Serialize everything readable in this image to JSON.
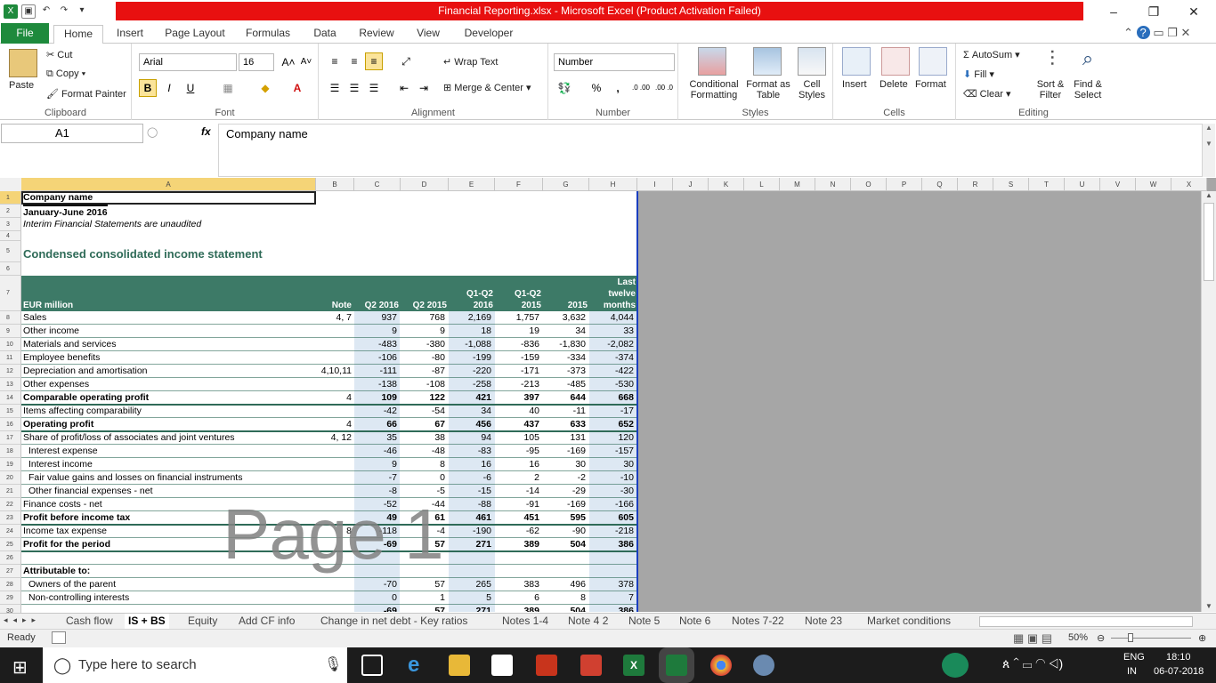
{
  "window": {
    "title": "Financial Reporting.xlsx  -  Microsoft Excel (Product Activation Failed)",
    "controls": {
      "minimize": "–",
      "restore": "❐",
      "close": "✕"
    }
  },
  "ribbon_tabs": [
    "File",
    "Home",
    "Insert",
    "Page Layout",
    "Formulas",
    "Data",
    "Review",
    "View",
    "Developer"
  ],
  "clipboard": {
    "paste": "Paste",
    "cut": "Cut",
    "copy": "Copy",
    "format_painter": "Format Painter",
    "label": "Clipboard"
  },
  "font": {
    "name": "Arial",
    "size": "16",
    "bold": "B",
    "italic": "I",
    "underline": "U",
    "label": "Font"
  },
  "alignment": {
    "wrap": "Wrap Text",
    "merge": "Merge & Center",
    "label": "Alignment"
  },
  "number": {
    "format": "Number",
    "percent": "%",
    "comma": ",",
    "inc": ".0 .00",
    "dec": ".00 .0",
    "label": "Number"
  },
  "styles": {
    "conditional": "Conditional Formatting",
    "format_table": "Format as Table",
    "cell_styles": "Cell Styles",
    "label": "Styles"
  },
  "cells": {
    "insert": "Insert",
    "delete": "Delete",
    "format": "Format",
    "label": "Cells"
  },
  "editing": {
    "autosum": "AutoSum",
    "fill": "Fill",
    "clear": "Clear",
    "sort": "Sort & Filter",
    "find": "Find & Select",
    "label": "Editing"
  },
  "formula_bar": {
    "name_box": "A1",
    "fx": "fx",
    "content": "Company name"
  },
  "columns": [
    "A",
    "B",
    "C",
    "D",
    "E",
    "F",
    "G",
    "H",
    "I",
    "J",
    "K",
    "L",
    "M",
    "N",
    "O",
    "P",
    "Q",
    "R",
    "S",
    "T",
    "U",
    "V",
    "W",
    "X"
  ],
  "sheet": {
    "r1": "Company name",
    "r2": "January-June 2016",
    "r3": "Interim Financial Statements are unaudited",
    "r5": "Condensed consolidated income statement",
    "header": {
      "label": "EUR million",
      "note": "Note",
      "c": "Q2 2016",
      "d": "Q2 2015",
      "e": [
        "Q1-Q2",
        "2016"
      ],
      "f": [
        "Q1-Q2",
        "2015"
      ],
      "g": "2015",
      "h": [
        "Last",
        "twelve",
        "months"
      ]
    },
    "rows": [
      {
        "n": "8",
        "a": "Sales",
        "b": "4, 7",
        "v": [
          "937",
          "768",
          "2,169",
          "1,757",
          "3,632",
          "4,044"
        ],
        "bold": false,
        "indent": false
      },
      {
        "n": "9",
        "a": "Other income",
        "b": "",
        "v": [
          "9",
          "9",
          "18",
          "19",
          "34",
          "33"
        ],
        "bold": false,
        "indent": false
      },
      {
        "n": "10",
        "a": "Materials and services",
        "b": "",
        "v": [
          "-483",
          "-380",
          "-1,088",
          "-836",
          "-1,830",
          "-2,082"
        ],
        "bold": false,
        "indent": false
      },
      {
        "n": "11",
        "a": "Employee benefits",
        "b": "",
        "v": [
          "-106",
          "-80",
          "-199",
          "-159",
          "-334",
          "-374"
        ],
        "bold": false,
        "indent": false
      },
      {
        "n": "12",
        "a": "Depreciation and amortisation",
        "b": "4,10,11",
        "v": [
          "-111",
          "-87",
          "-220",
          "-171",
          "-373",
          "-422"
        ],
        "bold": false,
        "indent": false
      },
      {
        "n": "13",
        "a": "Other expenses",
        "b": "",
        "v": [
          "-138",
          "-108",
          "-258",
          "-213",
          "-485",
          "-530"
        ],
        "bold": false,
        "indent": false
      },
      {
        "n": "14",
        "a": "Comparable operating profit",
        "b": "4",
        "v": [
          "109",
          "122",
          "421",
          "397",
          "644",
          "668"
        ],
        "bold": true,
        "indent": false
      },
      {
        "n": "15",
        "a": "Items affecting comparability",
        "b": "",
        "v": [
          "-42",
          "-54",
          "34",
          "40",
          "-11",
          "-17"
        ],
        "bold": false,
        "indent": false
      },
      {
        "n": "16",
        "a": "Operating profit",
        "b": "4",
        "v": [
          "66",
          "67",
          "456",
          "437",
          "633",
          "652"
        ],
        "bold": true,
        "indent": false
      },
      {
        "n": "17",
        "a": "Share of profit/loss of associates and joint ventures",
        "b": "4, 12",
        "v": [
          "35",
          "38",
          "94",
          "105",
          "131",
          "120"
        ],
        "bold": false,
        "indent": false
      },
      {
        "n": "18",
        "a": "Interest expense",
        "b": "",
        "v": [
          "-46",
          "-48",
          "-83",
          "-95",
          "-169",
          "-157"
        ],
        "bold": false,
        "indent": true
      },
      {
        "n": "19",
        "a": "Interest income",
        "b": "",
        "v": [
          "9",
          "8",
          "16",
          "16",
          "30",
          "30"
        ],
        "bold": false,
        "indent": true
      },
      {
        "n": "20",
        "a": "Fair value gains and losses on financial instruments",
        "b": "",
        "v": [
          "-7",
          "0",
          "-6",
          "2",
          "-2",
          "-10"
        ],
        "bold": false,
        "indent": true
      },
      {
        "n": "21",
        "a": "Other financial expenses - net",
        "b": "",
        "v": [
          "-8",
          "-5",
          "-15",
          "-14",
          "-29",
          "-30"
        ],
        "bold": false,
        "indent": true
      },
      {
        "n": "22",
        "a": "Finance costs - net",
        "b": "",
        "v": [
          "-52",
          "-44",
          "-88",
          "-91",
          "-169",
          "-166"
        ],
        "bold": false,
        "indent": false
      },
      {
        "n": "23",
        "a": "Profit before income tax",
        "b": "",
        "v": [
          "49",
          "61",
          "461",
          "451",
          "595",
          "605"
        ],
        "bold": true,
        "indent": false
      },
      {
        "n": "24",
        "a": "Income tax expense",
        "b": "8",
        "v": [
          "-118",
          "-4",
          "-190",
          "-62",
          "-90",
          "-218"
        ],
        "bold": false,
        "indent": false
      },
      {
        "n": "25",
        "a": "Profit for the period",
        "b": "",
        "v": [
          "-69",
          "57",
          "271",
          "389",
          "504",
          "386"
        ],
        "bold": true,
        "indent": false
      },
      {
        "n": "26",
        "a": "",
        "b": "",
        "v": [
          "",
          "",
          "",
          "",
          "",
          ""
        ],
        "bold": false,
        "indent": false
      },
      {
        "n": "27",
        "a": "Attributable to:",
        "b": "",
        "v": [
          "",
          "",
          "",
          "",
          "",
          ""
        ],
        "bold": true,
        "indent": false
      },
      {
        "n": "28",
        "a": "Owners of the parent",
        "b": "",
        "v": [
          "-70",
          "57",
          "265",
          "383",
          "496",
          "378"
        ],
        "bold": false,
        "indent": true
      },
      {
        "n": "29",
        "a": "Non-controlling interests",
        "b": "",
        "v": [
          "0",
          "1",
          "5",
          "6",
          "8",
          "7"
        ],
        "bold": false,
        "indent": true
      },
      {
        "n": "30",
        "a": "",
        "b": "",
        "v": [
          "-69",
          "57",
          "271",
          "389",
          "504",
          "386"
        ],
        "bold": true,
        "indent": false
      }
    ],
    "watermark": "Page 1"
  },
  "sheet_tabs": [
    "Cash flow",
    "IS + BS",
    "Equity",
    "Add CF info",
    "Change in net debt - Key ratios",
    "Notes 1-4",
    "Note 4 2",
    "Note 5",
    "Note 6",
    "Notes 7-22",
    "Note 23",
    "Market conditions"
  ],
  "active_sheet": "IS + BS",
  "status": {
    "ready": "Ready",
    "zoom": "50%"
  },
  "taskbar": {
    "search": "Type here to search",
    "lang1": "ENG",
    "lang2": "IN",
    "time": "18:10",
    "date": "06-07-2018"
  },
  "colors": {
    "header_band": "#3d7a67",
    "shade": "#dde8f3",
    "file_tab": "#1e8a3c",
    "title_red": "#e81010"
  }
}
